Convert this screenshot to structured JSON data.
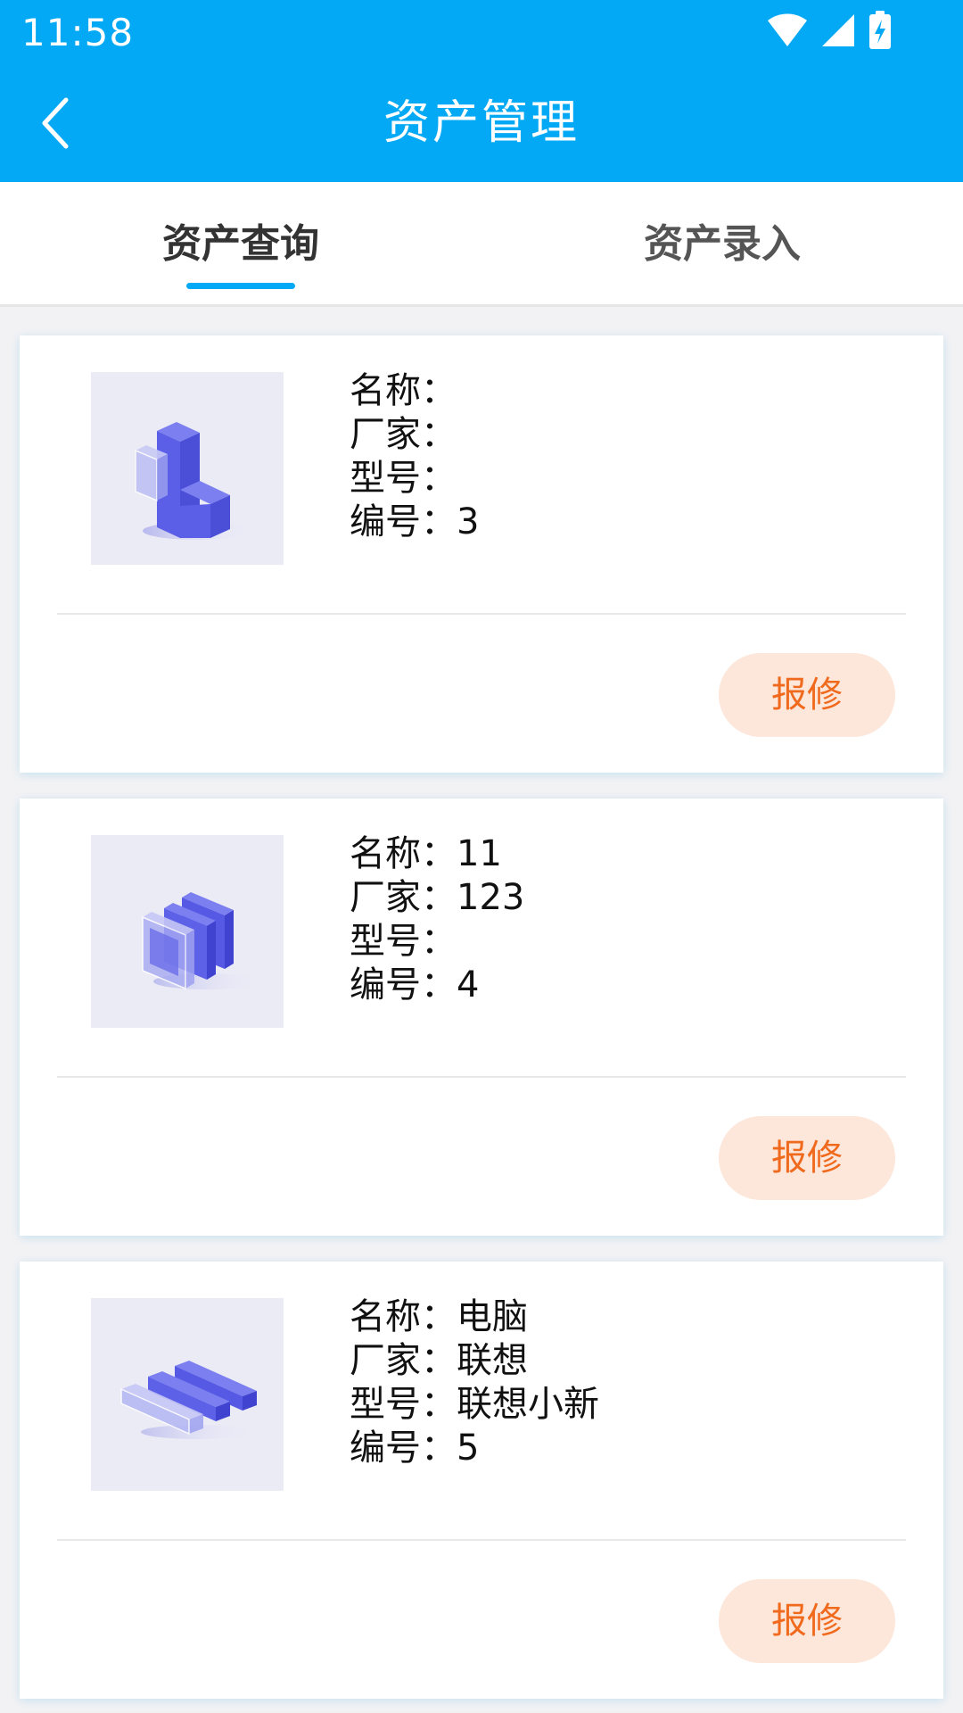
{
  "status_bar": {
    "time": "11:58",
    "icons": [
      "wifi-icon",
      "cellular-signal-icon",
      "battery-charging-icon"
    ]
  },
  "header": {
    "title": "资产管理",
    "back_icon": "chevron-left-icon"
  },
  "tabs": [
    {
      "label": "资产查询",
      "active": true
    },
    {
      "label": "资产录入",
      "active": false
    }
  ],
  "assets": [
    {
      "image_icon": "abstract-3d-blocks-icon",
      "name_label": "名称：",
      "name": "",
      "maker_label": "厂家：",
      "maker": "",
      "model_label": "型号：",
      "model": "",
      "number_label": "编号：",
      "number": "3",
      "action_label": "报修"
    },
    {
      "image_icon": "abstract-3d-panels-icon",
      "name_label": "名称：",
      "name": "11",
      "maker_label": "厂家：",
      "maker": "123",
      "model_label": "型号：",
      "model": "",
      "number_label": "编号：",
      "number": "4",
      "action_label": "报修"
    },
    {
      "image_icon": "abstract-3d-bars-icon",
      "name_label": "名称：",
      "name": "电脑",
      "maker_label": "厂家：",
      "maker": "联想",
      "model_label": "型号：",
      "model": "联想小新",
      "number_label": "编号：",
      "number": "5",
      "action_label": "报修"
    }
  ],
  "colors": {
    "primary": "#03a9f4",
    "action_text": "#f06a1e",
    "action_bg": "#fde6da",
    "page_bg": "#f2f2f4"
  }
}
